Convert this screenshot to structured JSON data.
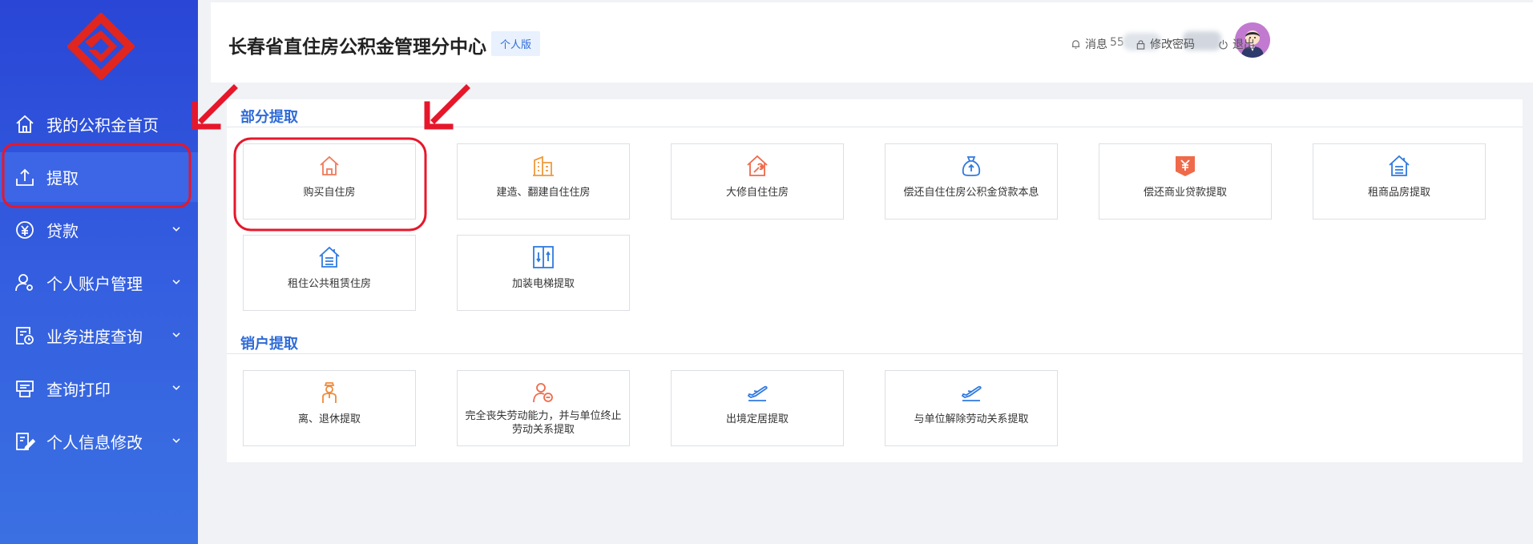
{
  "colors": {
    "sidebar": "#2f55dc",
    "accent": "#2f6bd8",
    "annotation": "#e6172b",
    "orange": "#ef8a3c"
  },
  "sidebar": {
    "items": [
      {
        "label": "我的公积金首页",
        "icon": "home-icon",
        "expandable": false
      },
      {
        "label": "提取",
        "icon": "upload-icon",
        "expandable": false,
        "active": true
      },
      {
        "label": "贷款",
        "icon": "yuan-icon",
        "expandable": true
      },
      {
        "label": "个人账户管理",
        "icon": "user-settings-icon",
        "expandable": true
      },
      {
        "label": "业务进度查询",
        "icon": "progress-query-icon",
        "expandable": true
      },
      {
        "label": "查询打印",
        "icon": "printer-icon",
        "expandable": true
      },
      {
        "label": "个人信息修改",
        "icon": "edit-info-icon",
        "expandable": true
      }
    ]
  },
  "header": {
    "title": "长春省直住房公积金管理分中心",
    "edition": "个人版",
    "user_id_prefix": "55",
    "links": {
      "messages": "消息",
      "change_password": "修改密码",
      "logout": "退出"
    }
  },
  "sections": [
    {
      "title": "部分提取",
      "cards": [
        {
          "label": "购买自住房",
          "icon": "house-icon"
        },
        {
          "label": "建造、翻建自住住房",
          "icon": "building-icon"
        },
        {
          "label": "大修自住住房",
          "icon": "house-repair-icon"
        },
        {
          "label": "偿还自住住房公积金贷款本息",
          "icon": "money-bag-icon"
        },
        {
          "label": "偿还商业贷款提取",
          "icon": "yuan-card-icon"
        },
        {
          "label": "租商品房提取",
          "icon": "rent-house-icon"
        },
        {
          "label": "租住公共租赁住房",
          "icon": "rent-house-icon"
        },
        {
          "label": "加装电梯提取",
          "icon": "elevator-icon"
        }
      ]
    },
    {
      "title": "销户提取",
      "cards": [
        {
          "label": "离、退休提取",
          "icon": "retiree-icon"
        },
        {
          "label": "完全丧失劳动能力，并与单位终止劳动关系提取",
          "icon": "disability-icon"
        },
        {
          "label": "出境定居提取",
          "icon": "plane-icon"
        },
        {
          "label": "与单位解除劳动关系提取",
          "icon": "plane-icon"
        }
      ]
    }
  ]
}
